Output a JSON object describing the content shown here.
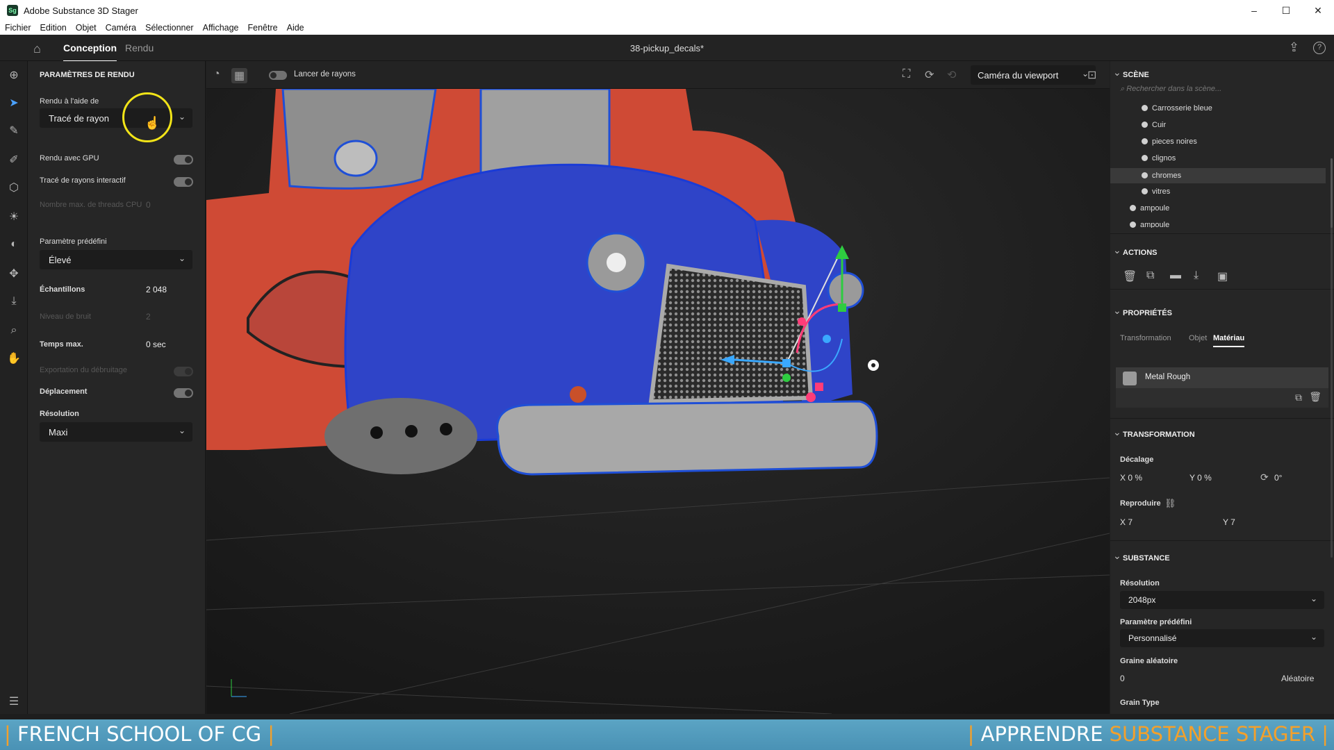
{
  "window": {
    "title": "Adobe Substance 3D Stager",
    "app_icon": "Sg",
    "controls": [
      "minimize",
      "maximize",
      "close"
    ]
  },
  "menu": [
    "Fichier",
    "Edition",
    "Objet",
    "Caméra",
    "Sélectionner",
    "Affichage",
    "Fenêtre",
    "Aide"
  ],
  "topbar": {
    "tabs": [
      "Conception",
      "Rendu"
    ],
    "active_tab": "Conception",
    "document_title": "38-pickup_decals*"
  },
  "render_panel": {
    "title": "PARAMÈTRES DE RENDU",
    "render_with_label": "Rendu à l'aide de",
    "render_with_value": "Tracé de rayon",
    "gpu_label": "Rendu avec GPU",
    "gpu_on": true,
    "interactive_label": "Tracé de rayons interactif",
    "interactive_on": true,
    "threads_label": "Nombre max. de threads CPU",
    "threads_value": "0",
    "preset_label": "Paramètre prédéfini",
    "preset_value": "Élevé",
    "samples_label": "Échantillons",
    "samples_value": "2 048",
    "noise_label": "Niveau de bruit",
    "noise_value": "2",
    "time_label": "Temps max.",
    "time_value": "0 sec",
    "debug_label": "Exportation du débruitage",
    "displacement_label": "Déplacement",
    "displacement_on": true,
    "resolution_label": "Résolution",
    "resolution_value": "Maxi"
  },
  "viewport": {
    "raytrace_label": "Lancer de rayons",
    "camera_value": "Caméra du viewport"
  },
  "scene": {
    "title": "SCÈNE",
    "search_placeholder": "Rechercher dans la scène...",
    "items": [
      "Carrosserie bleue",
      "Cuir",
      "pieces noires",
      "clignos",
      "chromes",
      "vitres"
    ],
    "selected_item": "chromes",
    "lights": [
      "ampoule",
      "ampoule"
    ]
  },
  "actions": {
    "title": "ACTIONS"
  },
  "properties": {
    "title": "PROPRIÉTÉS",
    "tabs": [
      "Transformation",
      "Objet",
      "Matériau"
    ],
    "active_tab": "Matériau",
    "material_name": "Metal Rough"
  },
  "transformation": {
    "title": "TRANSFORMATION",
    "offset_label": "Décalage",
    "offset_x": "X 0 %",
    "offset_y": "Y 0 %",
    "rotation": "0°",
    "repeat_label": "Reproduire",
    "repeat_x": "X 7",
    "repeat_y": "Y 7"
  },
  "substance": {
    "title": "SUBSTANCE",
    "resolution_label": "Résolution",
    "resolution_value": "2048px",
    "preset_label": "Paramètre prédéfini",
    "preset_value": "Personnalisé",
    "seed_label": "Graine aléatoire",
    "seed_value": "0",
    "seed_button": "Aléatoire",
    "grain_label": "Grain Type"
  },
  "banner": {
    "left": "FRENCH SCHOOL OF CG",
    "right_prefix": "APPRENDRE",
    "right_accent": "SUBSTANCE STAGER",
    "pipe": "|"
  },
  "colors": {
    "accent_blue": "#4ba1ff",
    "highlight_ring": "#f2e418",
    "banner_bg": "#4f98bb",
    "banner_accent": "#f3a02b",
    "truck_red": "#d94a35",
    "truck_blue": "#2f44c8"
  }
}
